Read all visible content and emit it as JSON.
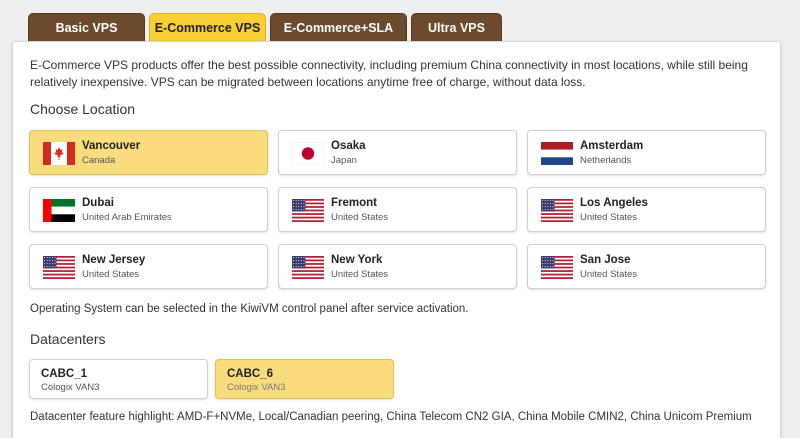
{
  "tabs": [
    {
      "label": "Basic VPS",
      "active": false
    },
    {
      "label": "E-Commerce VPS",
      "active": true
    },
    {
      "label": "E-Commerce+SLA",
      "active": false
    },
    {
      "label": "Ultra VPS",
      "active": false
    }
  ],
  "intro": "E-Commerce VPS products offer the best possible connectivity, including premium China connectivity in most locations, while still being relatively inexpensive. VPS can be migrated between locations anytime free of charge, without data loss.",
  "location_section": {
    "title": "Choose Location",
    "locations": [
      {
        "name": "Vancouver",
        "country": "Canada",
        "flag": "canada-flag-icon",
        "selected": true
      },
      {
        "name": "Osaka",
        "country": "Japan",
        "flag": "japan-flag-icon",
        "selected": false
      },
      {
        "name": "Amsterdam",
        "country": "Netherlands",
        "flag": "netherlands-flag-icon",
        "selected": false
      },
      {
        "name": "Dubai",
        "country": "United Arab Emirates",
        "flag": "uae-flag-icon",
        "selected": false
      },
      {
        "name": "Fremont",
        "country": "United States",
        "flag": "usa-flag-icon",
        "selected": false
      },
      {
        "name": "Los Angeles",
        "country": "United States",
        "flag": "usa-flag-icon",
        "selected": false
      },
      {
        "name": "New Jersey",
        "country": "United States",
        "flag": "usa-flag-icon",
        "selected": false
      },
      {
        "name": "New York",
        "country": "United States",
        "flag": "usa-flag-icon",
        "selected": false
      },
      {
        "name": "San Jose",
        "country": "United States",
        "flag": "usa-flag-icon",
        "selected": false
      }
    ]
  },
  "os_note": "Operating System can be selected in the KiwiVM control panel after service activation.",
  "datacenter_section": {
    "title": "Datacenters",
    "datacenters": [
      {
        "name": "CABC_1",
        "provider": "Cologix VAN3",
        "selected": false
      },
      {
        "name": "CABC_6",
        "provider": "Cologix VAN3",
        "selected": true
      }
    ],
    "feature": "Datacenter feature highlight: AMD-F+NVMe, Local/Canadian peering, China Telecom CN2 GIA, China Mobile CMIN2, China Unicom Premium"
  },
  "colors": {
    "tab_bg": "#6b4b2c",
    "accent": "#f7ce34",
    "selected_card": "#f8dc7d"
  }
}
